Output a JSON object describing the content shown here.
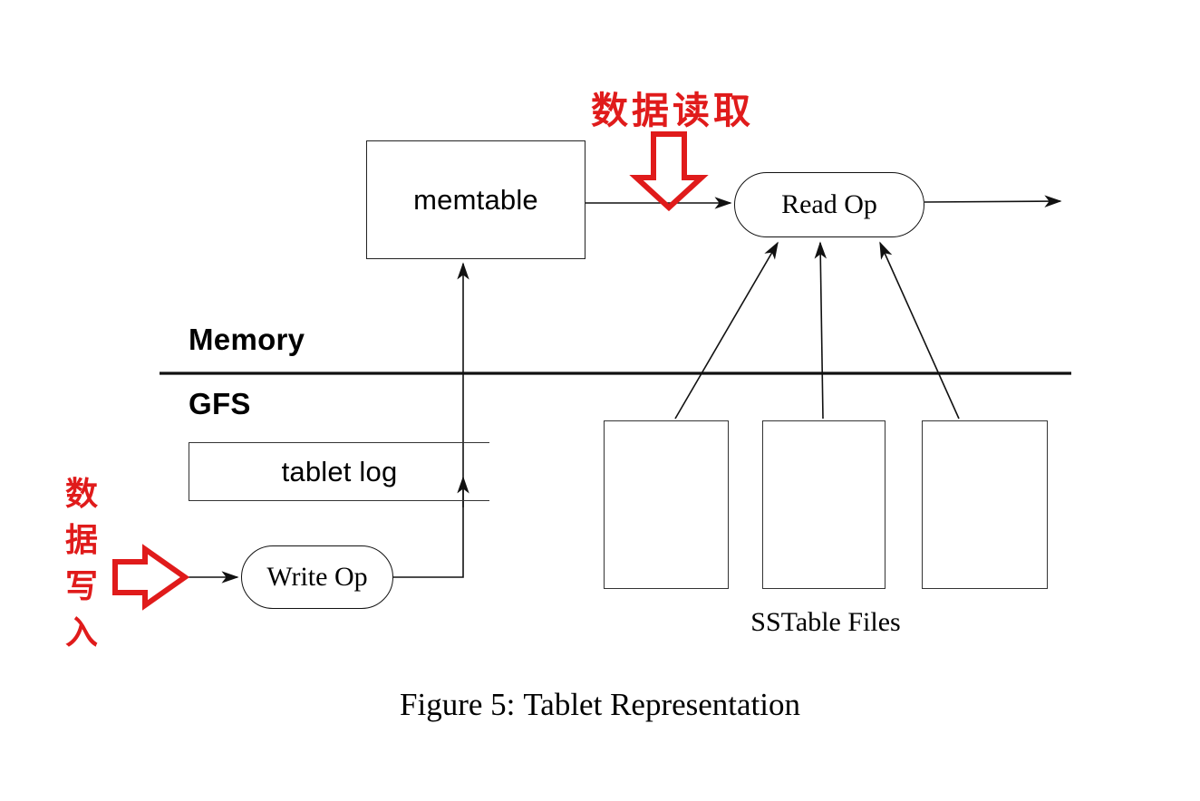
{
  "figure": {
    "caption_number": "Figure 5:",
    "caption_title": "Tablet Representation"
  },
  "diagram": {
    "title": "Tablet Representation",
    "tiers": [
      {
        "id": "memory",
        "label": "Memory"
      },
      {
        "id": "gfs",
        "label": "GFS"
      }
    ],
    "nodes": {
      "memtable": {
        "label": "memtable",
        "shape": "rectangle",
        "tier": "memory"
      },
      "read_op": {
        "label": "Read Op",
        "shape": "stadium",
        "tier": "memory"
      },
      "write_op": {
        "label": "Write Op",
        "shape": "stadium",
        "tier": "gfs"
      },
      "tablet_log": {
        "label": "tablet log",
        "shape": "open-rectangle",
        "tier": "gfs"
      }
    },
    "sstables": {
      "caption": "SSTable Files",
      "boxes": [
        {
          "label": ""
        },
        {
          "label": ""
        },
        {
          "label": ""
        }
      ]
    }
  },
  "annotations": {
    "read_path": {
      "text": "数据读取",
      "meaning": "data read",
      "color": "#e01b1b",
      "arrow": "down-arrow-outline"
    },
    "write_path": {
      "text": "数据写入",
      "chars": [
        "数",
        "据",
        "写",
        "入"
      ],
      "meaning": "data write",
      "color": "#e01b1b",
      "arrow": "right-arrow-outline"
    }
  },
  "colors": {
    "annotation_red": "#e01b1b",
    "stroke_black": "#222222",
    "background": "#ffffff"
  }
}
